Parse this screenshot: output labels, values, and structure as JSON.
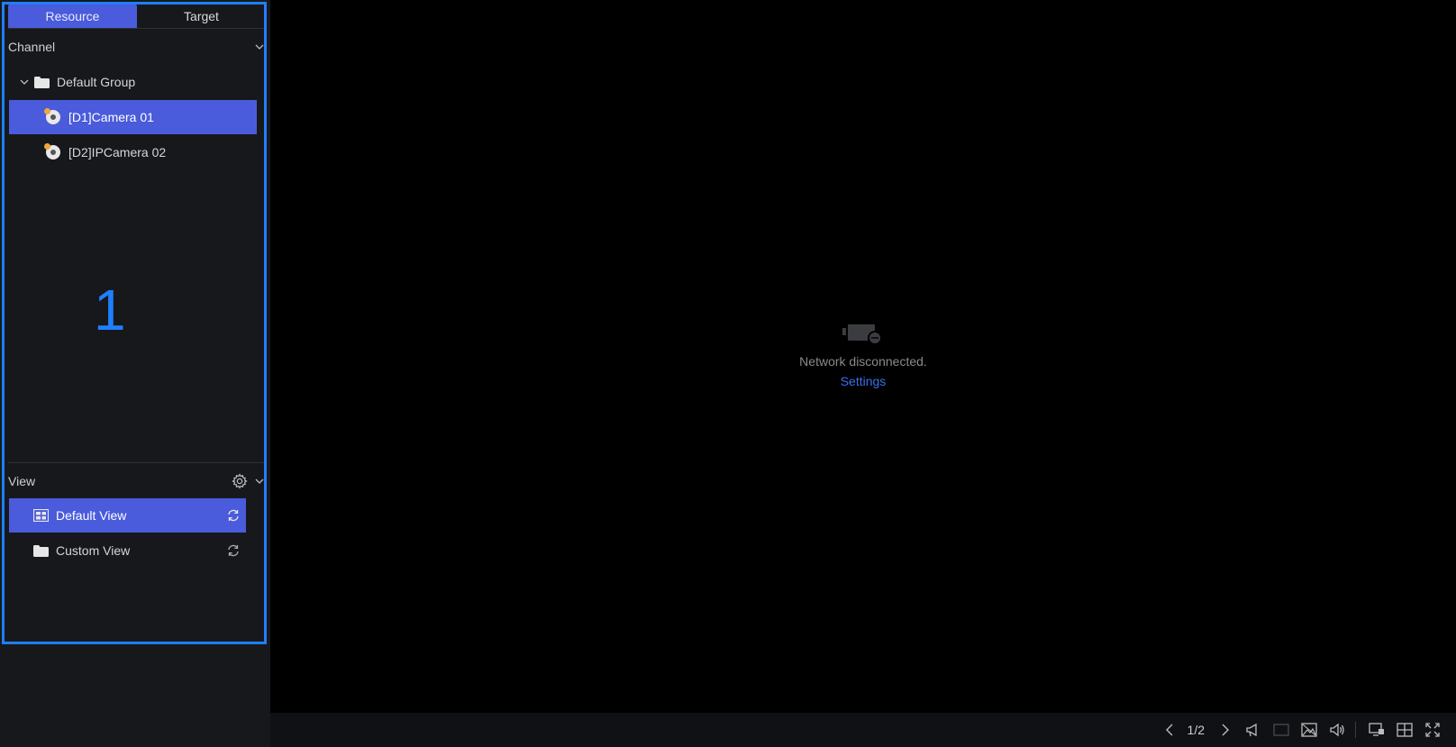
{
  "tabs": {
    "resource": "Resource",
    "target": "Target"
  },
  "channel": {
    "title": "Channel",
    "group": "Default Group",
    "items": [
      {
        "label": "[D1]Camera 01",
        "selected": true
      },
      {
        "label": "[D2]IPCamera 02",
        "selected": false
      }
    ]
  },
  "view": {
    "title": "View",
    "items": [
      {
        "label": "Default View",
        "icon": "grid-view-icon",
        "selected": true
      },
      {
        "label": "Custom View",
        "icon": "folder-icon",
        "selected": false
      }
    ]
  },
  "callout": "1",
  "main": {
    "status": "Network disconnected.",
    "settings_link": "Settings"
  },
  "bottom": {
    "page": "1/2"
  },
  "colors": {
    "accent": "#4a5bdc",
    "highlight": "#1f7fff",
    "link": "#3d6ef0"
  }
}
